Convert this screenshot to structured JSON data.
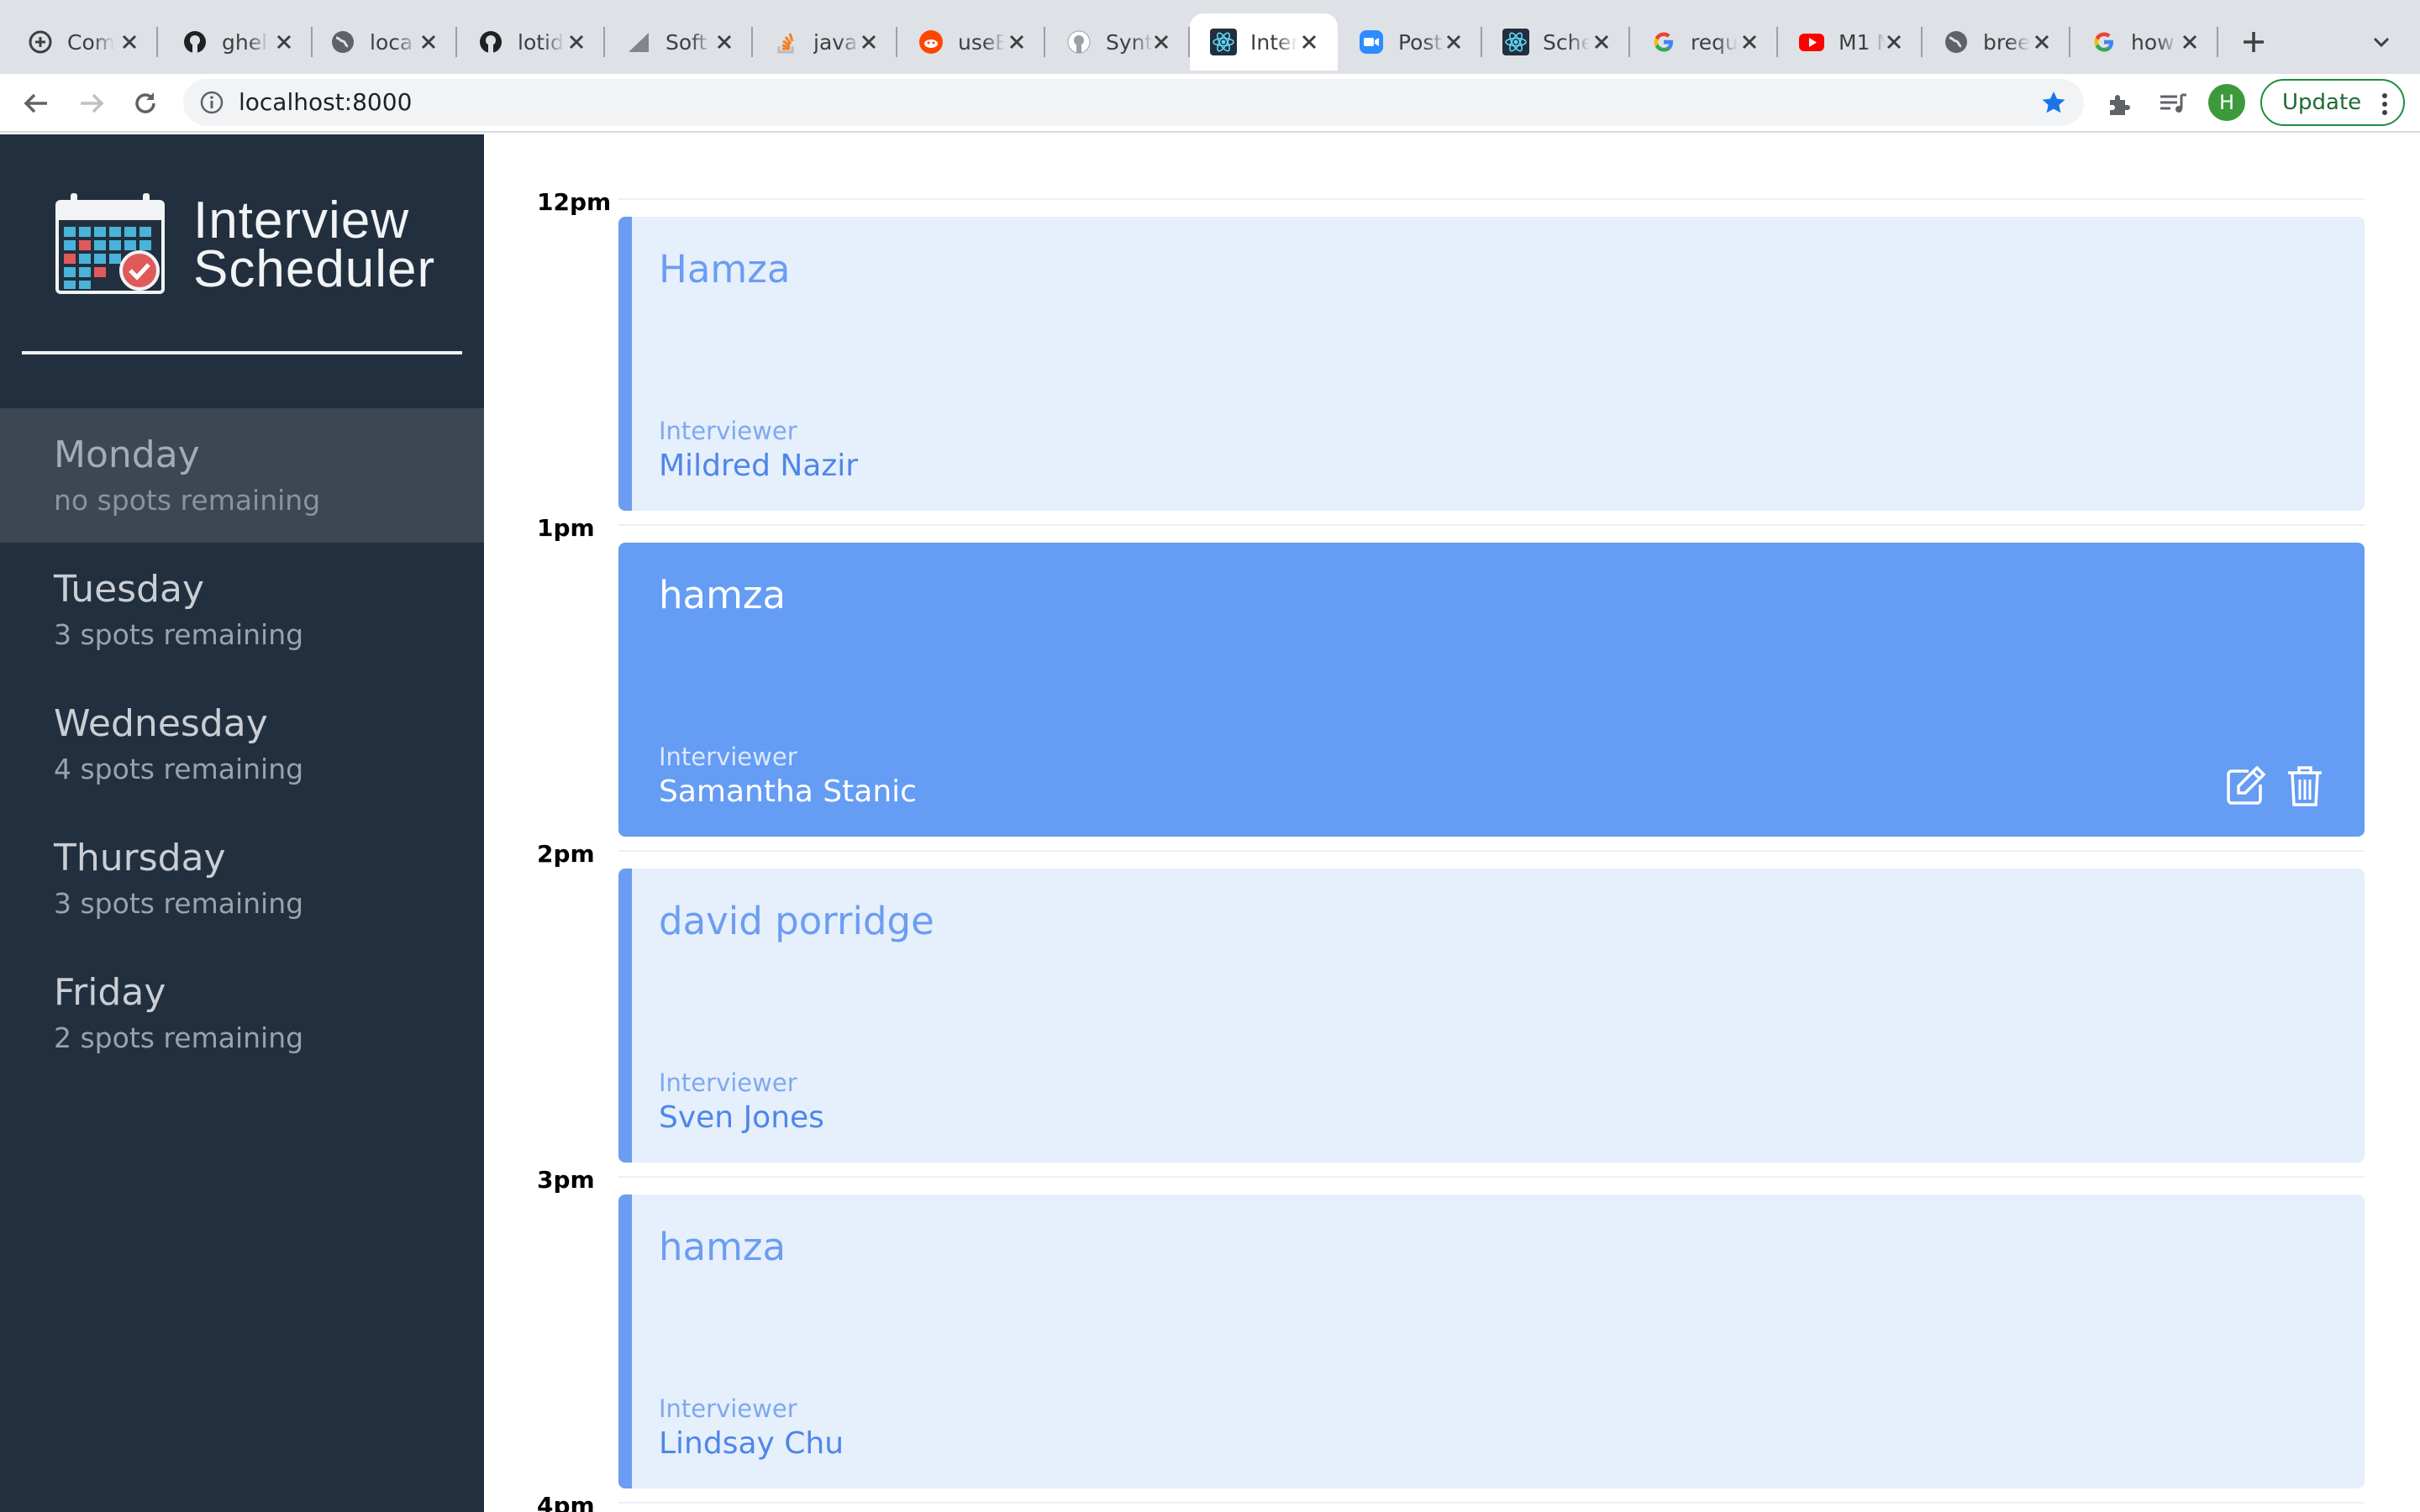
{
  "browser": {
    "tabs": [
      {
        "title": "Com",
        "icon": "plus-circle-icon"
      },
      {
        "title": "ghel",
        "icon": "github-icon"
      },
      {
        "title": "loca",
        "icon": "globe-icon"
      },
      {
        "title": "lotid",
        "icon": "github-icon"
      },
      {
        "title": "Soft",
        "icon": "softonic-icon"
      },
      {
        "title": "java",
        "icon": "stackoverflow-icon"
      },
      {
        "title": "useE",
        "icon": "reddit-icon"
      },
      {
        "title": "Synt",
        "icon": "github-icon"
      },
      {
        "title": "Inter",
        "icon": "react-icon",
        "active": true
      },
      {
        "title": "Post",
        "icon": "zoom-icon"
      },
      {
        "title": "Sche",
        "icon": "react-icon"
      },
      {
        "title": "requ",
        "icon": "google-icon"
      },
      {
        "title": "M1 M",
        "icon": "youtube-icon"
      },
      {
        "title": "bree",
        "icon": "globe-icon"
      },
      {
        "title": "how",
        "icon": "google-icon"
      }
    ],
    "url": "localhost:8000",
    "avatar_letter": "H",
    "update_label": "Update"
  },
  "app": {
    "name_line1": "Interview",
    "name_line2": "Scheduler"
  },
  "days": [
    {
      "name": "Monday",
      "spots": "no spots remaining",
      "selected": true
    },
    {
      "name": "Tuesday",
      "spots": "3 spots remaining"
    },
    {
      "name": "Wednesday",
      "spots": "4 spots remaining"
    },
    {
      "name": "Thursday",
      "spots": "3 spots remaining"
    },
    {
      "name": "Friday",
      "spots": "2 spots remaining"
    }
  ],
  "schedule": {
    "hours": [
      "12pm",
      "1pm",
      "2pm",
      "3pm",
      "4pm"
    ],
    "appointments": [
      {
        "student": "Hamza",
        "interviewer_label": "Interviewer",
        "interviewer": "Mildred Nazir"
      },
      {
        "student": "hamza",
        "interviewer_label": "Interviewer",
        "interviewer": "Samantha Stanic",
        "hovered": true
      },
      {
        "student": "david porridge",
        "interviewer_label": "Interviewer",
        "interviewer": "Sven Jones"
      },
      {
        "student": "hamza",
        "interviewer_label": "Interviewer",
        "interviewer": "Lindsay Chu"
      }
    ]
  },
  "colors": {
    "sidebar_bg": "#222f3e",
    "appointment_bg": "#e6effc",
    "appointment_accent": "#6b9df2",
    "appointment_hover_bg": "#659cf4"
  }
}
